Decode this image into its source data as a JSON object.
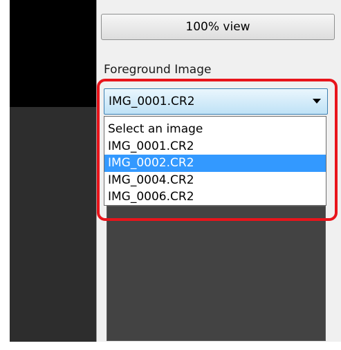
{
  "toolbar": {
    "view_button_label": "100% view"
  },
  "foreground": {
    "label": "Foreground Image",
    "selected_value": "IMG_0001.CR2",
    "options": [
      {
        "label": "Select an image"
      },
      {
        "label": "IMG_0001.CR2"
      },
      {
        "label": "IMG_0002.CR2",
        "highlighted": true
      },
      {
        "label": "IMG_0004.CR2"
      },
      {
        "label": "IMG_0006.CR2"
      }
    ]
  },
  "colors": {
    "highlight_outline": "#e8141b",
    "selection": "#3399ff",
    "viewer_background": "#2d2d2d"
  }
}
